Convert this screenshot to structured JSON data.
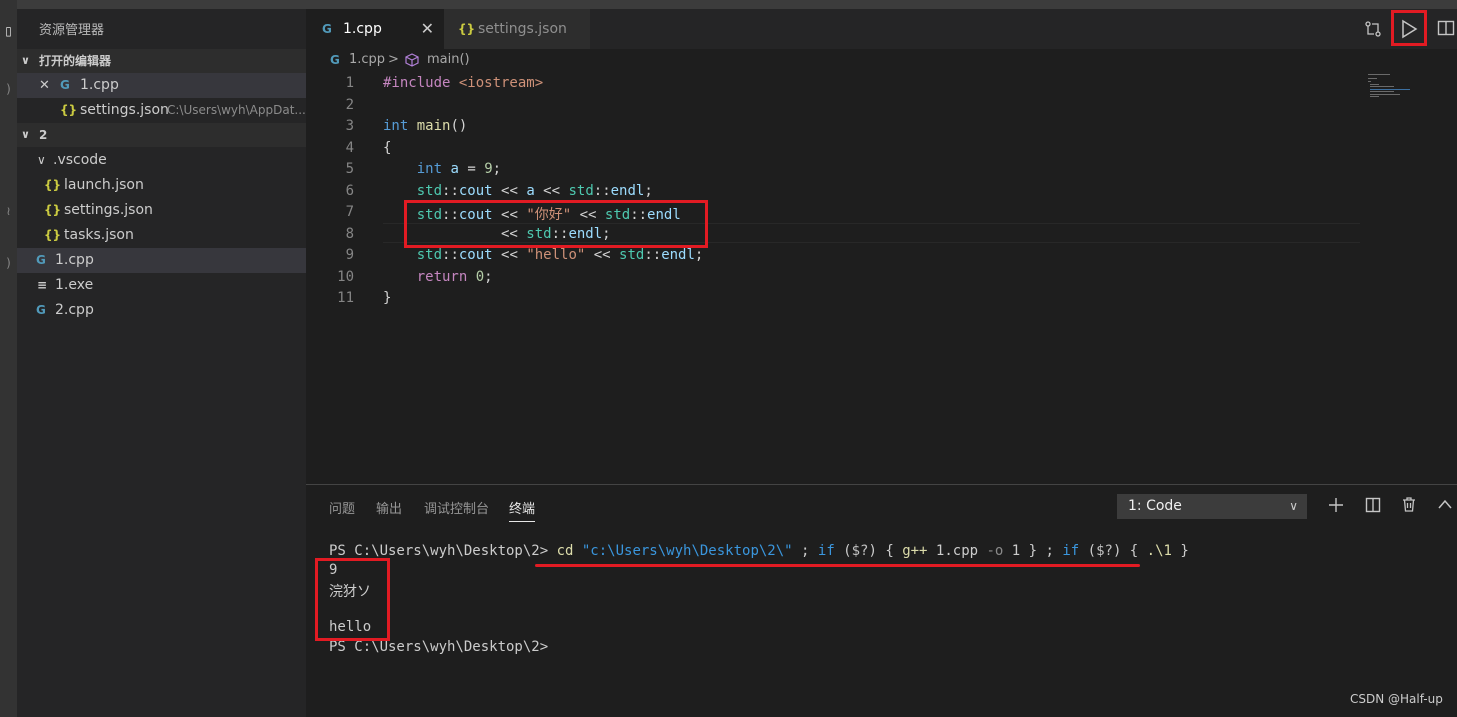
{
  "sidebar": {
    "title": "资源管理器",
    "open_editors_header": "打开的编辑器",
    "open_editors": [
      {
        "icon": "G",
        "name": "1.cpp",
        "close": "✕"
      },
      {
        "icon": "{}",
        "name": "settings.json",
        "desc": "C:\\Users\\wyh\\AppDat..."
      }
    ],
    "folder_header": "2",
    "tree": [
      {
        "icon": "",
        "name": ".vscode"
      },
      {
        "icon": "{}",
        "name": "launch.json"
      },
      {
        "icon": "{}",
        "name": "settings.json"
      },
      {
        "icon": "{}",
        "name": "tasks.json"
      },
      {
        "icon": "G",
        "name": "1.cpp"
      },
      {
        "icon": "≡",
        "name": "1.exe"
      },
      {
        "icon": "G",
        "name": "2.cpp"
      }
    ]
  },
  "tabs": [
    {
      "icon": "G",
      "label": "1.cpp",
      "close": "✕"
    },
    {
      "icon": "{}",
      "label": "settings.json"
    }
  ],
  "breadcrumb": {
    "file": "1.cpp",
    "sep": ">",
    "symbol": "main()"
  },
  "editor": {
    "line_numbers": [
      "1",
      "2",
      "3",
      "4",
      "5",
      "6",
      "7",
      "8",
      "9",
      "10",
      "11"
    ],
    "lines": [
      [
        {
          "t": "#include ",
          "c": "kw-inc"
        },
        {
          "t": "<iostream>",
          "c": "hdr"
        }
      ],
      [],
      [
        {
          "t": "int",
          "c": "kw"
        },
        {
          "t": " "
        },
        {
          "t": "main",
          "c": "fn"
        },
        {
          "t": "()"
        }
      ],
      [
        {
          "t": "{"
        }
      ],
      [
        {
          "t": "    "
        },
        {
          "t": "int",
          "c": "kw"
        },
        {
          "t": " "
        },
        {
          "t": "a",
          "c": "var"
        },
        {
          "t": " = "
        },
        {
          "t": "9",
          "c": "num"
        },
        {
          "t": ";"
        }
      ],
      [
        {
          "t": "    "
        },
        {
          "t": "std",
          "c": "ns"
        },
        {
          "t": "::"
        },
        {
          "t": "cout",
          "c": "var"
        },
        {
          "t": " << "
        },
        {
          "t": "a",
          "c": "var"
        },
        {
          "t": " << "
        },
        {
          "t": "std",
          "c": "ns"
        },
        {
          "t": "::"
        },
        {
          "t": "endl",
          "c": "var"
        },
        {
          "t": ";"
        }
      ],
      [
        {
          "t": "    "
        },
        {
          "t": "std",
          "c": "ns"
        },
        {
          "t": "::"
        },
        {
          "t": "cout",
          "c": "var"
        },
        {
          "t": " << "
        },
        {
          "t": "\"你好\"",
          "c": "str"
        },
        {
          "t": " << "
        },
        {
          "t": "std",
          "c": "ns"
        },
        {
          "t": "::"
        },
        {
          "t": "endl",
          "c": "var"
        }
      ],
      [
        {
          "t": "              << "
        },
        {
          "t": "std",
          "c": "ns"
        },
        {
          "t": "::"
        },
        {
          "t": "endl",
          "c": "var"
        },
        {
          "t": ";"
        }
      ],
      [
        {
          "t": "    "
        },
        {
          "t": "std",
          "c": "ns"
        },
        {
          "t": "::"
        },
        {
          "t": "cout",
          "c": "var"
        },
        {
          "t": " << "
        },
        {
          "t": "\"hello\"",
          "c": "str"
        },
        {
          "t": " << "
        },
        {
          "t": "std",
          "c": "ns"
        },
        {
          "t": "::"
        },
        {
          "t": "endl",
          "c": "var"
        },
        {
          "t": ";"
        }
      ],
      [
        {
          "t": "    "
        },
        {
          "t": "return",
          "c": "ret"
        },
        {
          "t": " "
        },
        {
          "t": "0",
          "c": "num"
        },
        {
          "t": ";"
        }
      ],
      [
        {
          "t": "}"
        }
      ]
    ]
  },
  "panel": {
    "tabs": [
      "问题",
      "输出",
      "调试控制台",
      "终端"
    ],
    "active_tab": "终端",
    "terminal_select": "1: Code",
    "terminal": {
      "line1": [
        {
          "t": "PS C:\\Users\\wyh\\Desktop\\2> "
        },
        {
          "t": "cd",
          "c": "t-cmd"
        },
        {
          "t": " "
        },
        {
          "t": "\"c:\\Users\\wyh\\Desktop\\2\\\"",
          "c": "t-str"
        },
        {
          "t": " ; "
        },
        {
          "t": "if",
          "c": "t-kw"
        },
        {
          "t": " ("
        },
        {
          "t": "$?",
          "c": "t-var"
        },
        {
          "t": ") { "
        },
        {
          "t": "g++",
          "c": "t-cmd"
        },
        {
          "t": " 1.cpp "
        },
        {
          "t": "-o",
          "c": "t-param"
        },
        {
          "t": " 1 } ; "
        },
        {
          "t": "if",
          "c": "t-kw"
        },
        {
          "t": " ("
        },
        {
          "t": "$?",
          "c": "t-var"
        },
        {
          "t": ") { "
        },
        {
          "t": ".\\1",
          "c": "t-cmd"
        },
        {
          "t": " }"
        }
      ],
      "out1": "9",
      "out2": "浣犲ソ",
      "out3": "",
      "out4": "hello",
      "prompt": "PS C:\\Users\\wyh\\Desktop\\2>"
    }
  },
  "watermark": "CSDN @Half-up",
  "colors": {
    "highlight": "#e21b23",
    "accent": "#519aba",
    "json": "#cbcb41"
  }
}
